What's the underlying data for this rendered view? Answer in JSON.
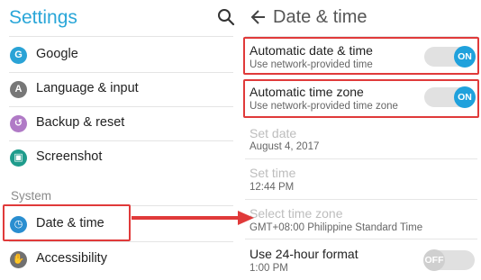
{
  "left": {
    "title": "Settings",
    "items": [
      {
        "label": "Google",
        "icon": "google-icon"
      },
      {
        "label": "Language & input",
        "icon": "language-icon"
      },
      {
        "label": "Backup & reset",
        "icon": "backup-icon"
      },
      {
        "label": "Screenshot",
        "icon": "screenshot-icon"
      }
    ],
    "section": "System",
    "system_items": [
      {
        "label": "Date & time",
        "icon": "clock-icon"
      },
      {
        "label": "Accessibility",
        "icon": "accessibility-icon"
      }
    ]
  },
  "right": {
    "title": "Date & time",
    "rows": [
      {
        "title": "Automatic date & time",
        "subtitle": "Use network-provided time",
        "toggle": "ON"
      },
      {
        "title": "Automatic time zone",
        "subtitle": "Use network-provided time zone",
        "toggle": "ON"
      },
      {
        "title": "Set date",
        "subtitle": "August 4, 2017"
      },
      {
        "title": "Set time",
        "subtitle": "12:44 PM"
      },
      {
        "title": "Select time zone",
        "subtitle": "GMT+08:00 Philippine Standard Time"
      },
      {
        "title": "Use 24-hour format",
        "subtitle": "1:00 PM",
        "toggle": "OFF"
      }
    ]
  },
  "colors": {
    "accent": "#29a6d8",
    "highlight": "#e03a3a",
    "toggle_on": "#1fa1dc"
  }
}
